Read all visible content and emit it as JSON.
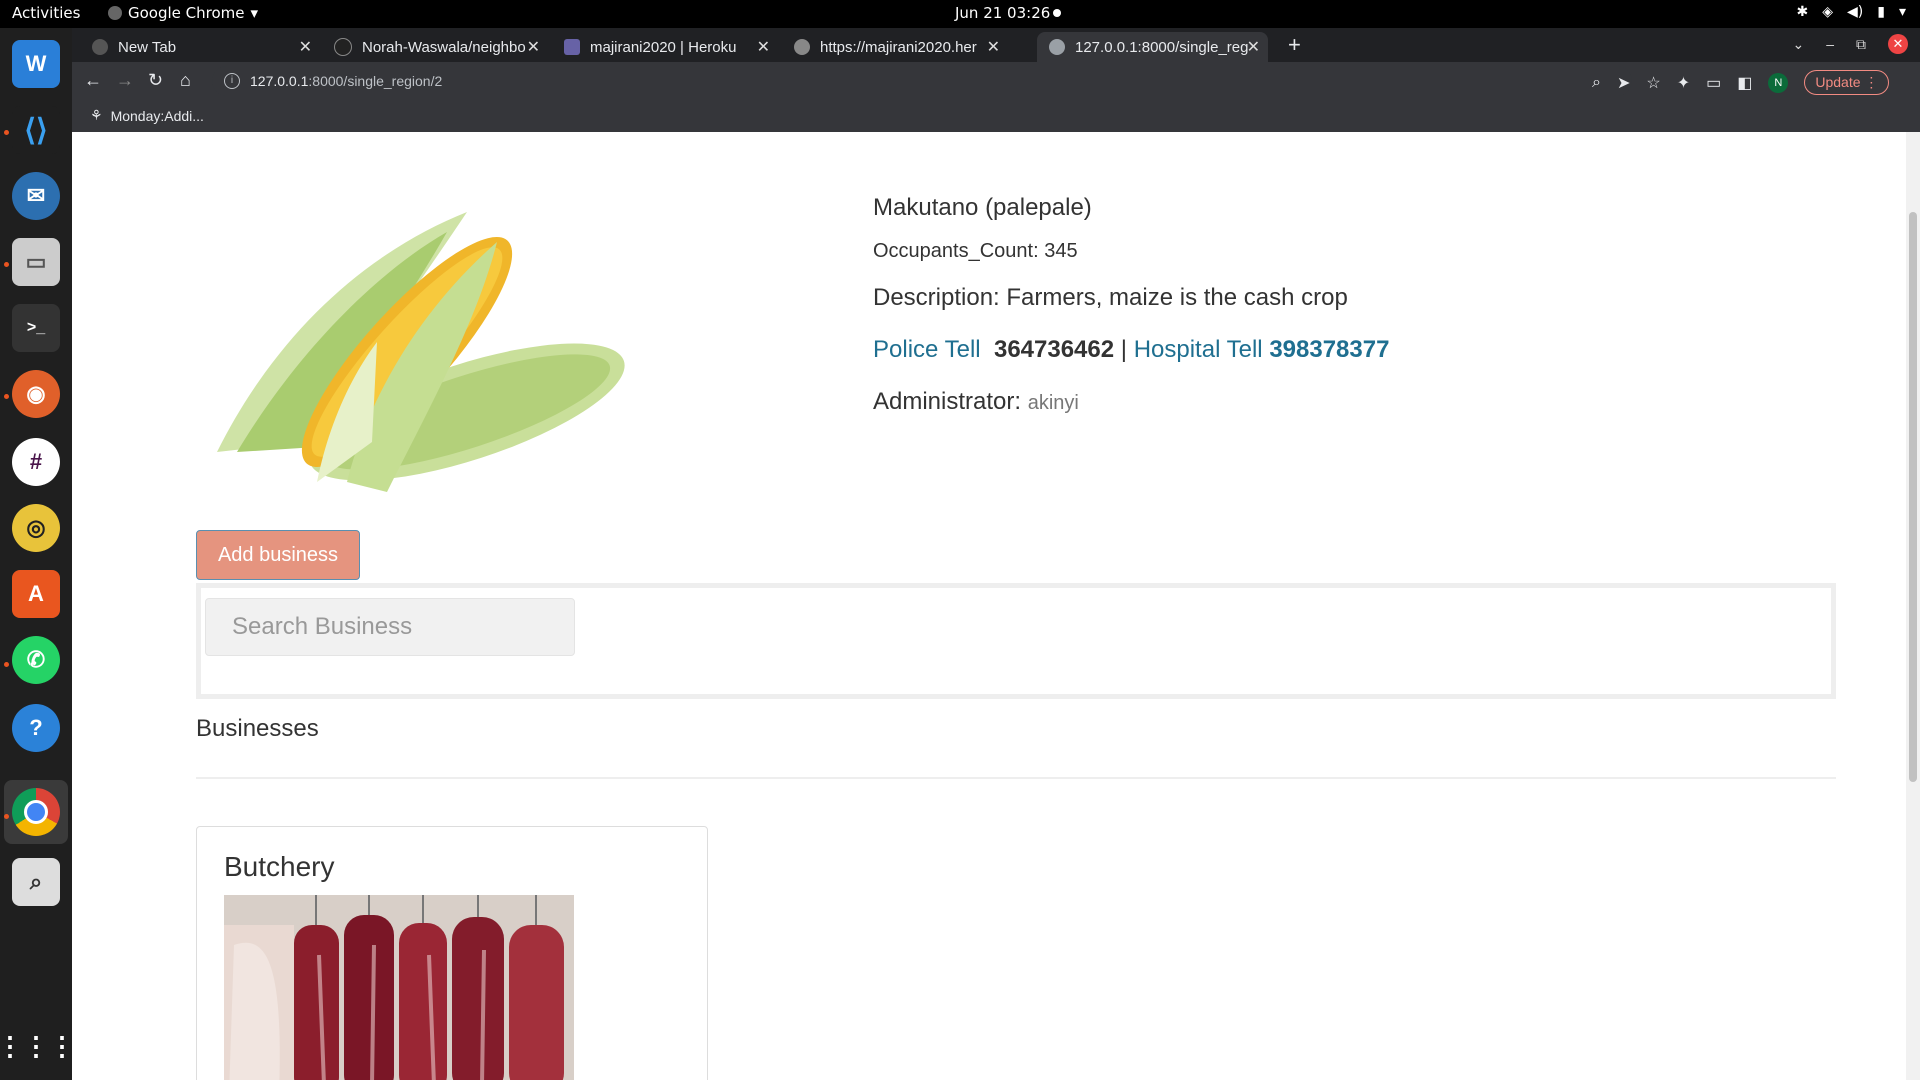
{
  "system": {
    "activities": "Activities",
    "app_name": "Google Chrome",
    "datetime": "Jun 21  03:26"
  },
  "dock": {
    "apps": [
      "libreoffice-writer-icon",
      "vscode-icon",
      "thunderbird-icon",
      "files-icon",
      "terminal-icon",
      "firefox-icon",
      "slack-icon",
      "rhythmbox-icon",
      "app-center-icon",
      "whatsapp-icon",
      "help-icon",
      "chrome-icon",
      "search-tool-icon",
      "app-grid-icon"
    ]
  },
  "browser": {
    "tabs": [
      {
        "title": "New Tab"
      },
      {
        "title": "Norah-Waswala/neighbo"
      },
      {
        "title": "majirani2020 | Heroku"
      },
      {
        "title": "https://majirani2020.her"
      },
      {
        "title": "127.0.0.1:8000/single_reg"
      }
    ],
    "url_host": "127.0.0.1",
    "url_rest": ":8000/single_region/2",
    "update_label": "Update",
    "profile_initial": "N",
    "bookmarks": [
      {
        "label": "Monday:Addi..."
      }
    ]
  },
  "region": {
    "name": "Makutano (palepale)",
    "occupants": "Occupants_Count: 345",
    "description": "Description: Farmers, maize is the cash crop",
    "police_label": "Police Tell",
    "police_number": "364736462",
    "separator": "|",
    "hospital_label": "Hospital Tell",
    "hospital_number": "398378377",
    "admin_label": "Administrator:",
    "admin_value": "akinyi"
  },
  "actions": {
    "add_business": "Add business",
    "search_placeholder": "Search Business"
  },
  "businesses": {
    "heading": "Businesses",
    "items": [
      {
        "name": "Butchery"
      }
    ]
  },
  "colors": {
    "accent_link": "#1f6f90",
    "add_button": "#e5947f"
  }
}
